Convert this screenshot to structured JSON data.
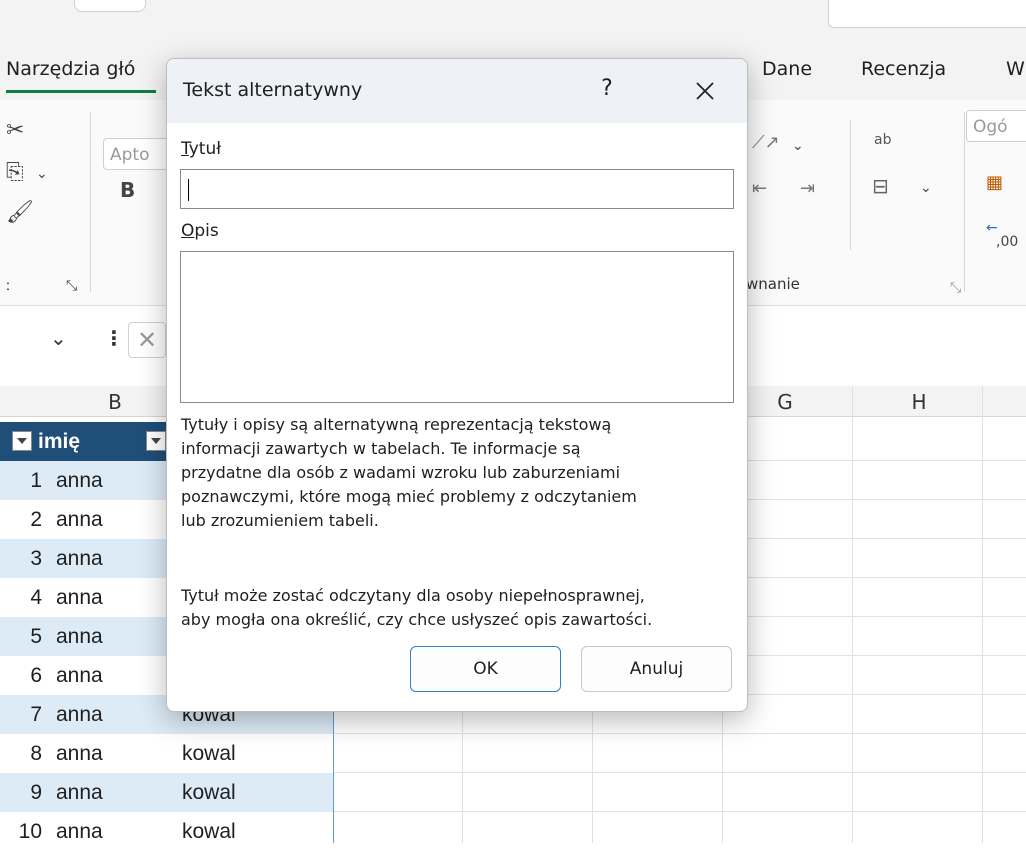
{
  "menu": {
    "tab_home": "Narzędzia głó",
    "tab_data": "Dane",
    "tab_review": "Recenzja",
    "tab_w": "W"
  },
  "ribbon": {
    "font_name": "Apto",
    "number_format": "Ogó",
    "bold_label": "B",
    "group_alignment": "wnanie",
    "group_clip_left": "ː",
    "wrap_text_label": "ab",
    "dec_label": ",00"
  },
  "grid": {
    "columns": [
      "B",
      "G",
      "H"
    ],
    "header": {
      "col_b": "imię"
    },
    "rows": [
      {
        "num": "1",
        "name": "anna",
        "surname": ""
      },
      {
        "num": "2",
        "name": "anna",
        "surname": ""
      },
      {
        "num": "3",
        "name": "anna",
        "surname": ""
      },
      {
        "num": "4",
        "name": "anna",
        "surname": ""
      },
      {
        "num": "5",
        "name": "anna",
        "surname": ""
      },
      {
        "num": "6",
        "name": "anna",
        "surname": ""
      },
      {
        "num": "7",
        "name": "anna",
        "surname": "kowal"
      },
      {
        "num": "8",
        "name": "anna",
        "surname": "kowal"
      },
      {
        "num": "9",
        "name": "anna",
        "surname": "kowal"
      },
      {
        "num": "10",
        "name": "anna",
        "surname": "kowal"
      }
    ]
  },
  "dialog": {
    "title": "Tekst alternatywny",
    "help": "?",
    "title_label_first": "T",
    "title_label_rest": "ytuł",
    "title_value": "",
    "desc_label_first": "O",
    "desc_label_rest": "pis",
    "desc_value": "",
    "help_text_1_lines": [
      "Tytuły i opisy są alternatywną reprezentacją tekstową",
      "informacji zawartych w tabelach. Te informacje są",
      "przydatne dla osób z wadami wzroku lub zaburzeniami",
      "poznawczymi, które mogą mieć problemy z odczytaniem",
      "lub zrozumieniem tabeli."
    ],
    "help_text_2_lines": [
      "Tytuł może zostać odczytany dla osoby niepełnosprawnej,",
      "aby mogła ona określić, czy chce usłyszeć opis zawartości."
    ],
    "ok_label": "OK",
    "cancel_label": "Anuluj"
  },
  "colors": {
    "table_header": "#1f4e79",
    "row_band": "#ddebf7",
    "ok_border": "#2f7fcc",
    "tab_underline": "#107c41"
  }
}
